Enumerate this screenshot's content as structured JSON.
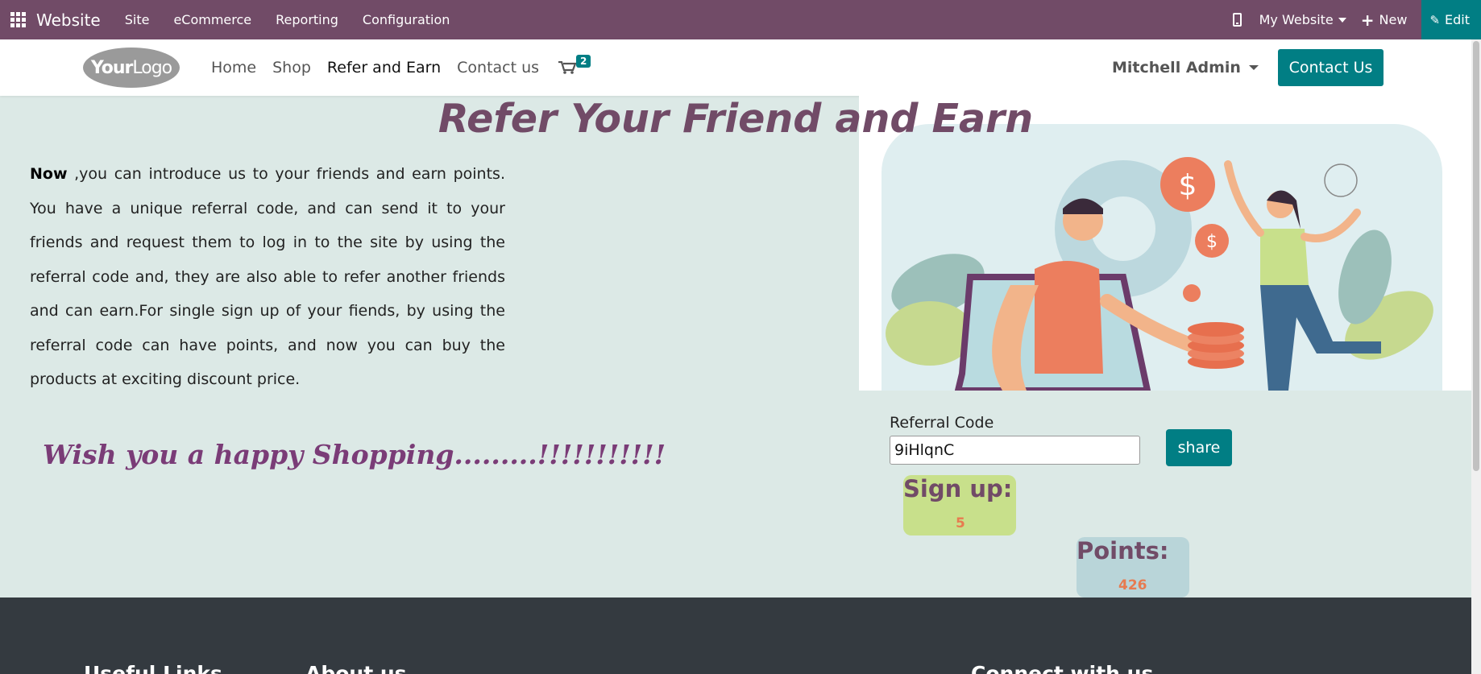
{
  "topbar": {
    "brand": "Website",
    "menus": [
      "Site",
      "eCommerce",
      "Reporting",
      "Configuration"
    ],
    "site_selector": "My Website",
    "new_label": "New",
    "edit_label": "Edit"
  },
  "header": {
    "logo_text_bold": "Your",
    "logo_text_light": "Logo",
    "nav": [
      "Home",
      "Shop",
      "Refer and Earn",
      "Contact us"
    ],
    "cart_count": "2",
    "user": "Mitchell Admin",
    "contact_button": "Contact Us"
  },
  "main": {
    "title": "Refer Your Friend and Earn",
    "intro_bold": "Now",
    "intro_text": " ,you can introduce us to your friends and earn points. You have a unique referral code, and can send it to your friends and request them to log in to the site by using the referral code and, they are also able to refer another friends and can earn.For single sign up of your fiends, by using the referral code can have points, and now you can buy the products at exciting discount price.",
    "wish": "Wish you a happy Shopping.........!!!!!!!!!!!",
    "referral_label": "Referral Code",
    "referral_code": "9iHlqnC",
    "share_button": "share",
    "signup_label": "Sign up:",
    "signup_value": "5",
    "points_label": "Points:",
    "points_value": "426"
  },
  "footer": {
    "headings": [
      "Useful Links",
      "About us",
      "Connect with us"
    ]
  },
  "colors": {
    "brand": "#714b67",
    "accent": "#017e84",
    "background": "#dce9e6",
    "value": "#e77b50"
  }
}
